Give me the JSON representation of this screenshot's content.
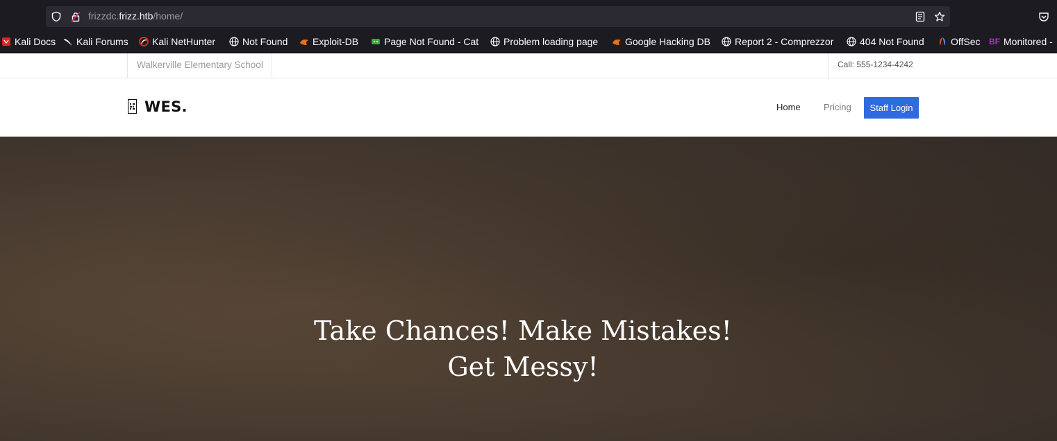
{
  "browser": {
    "url": {
      "host_prefix": "frizzdc.",
      "host_main": "frizz.htb",
      "path": "/home/"
    },
    "bookmarks": [
      {
        "label": "Kali Docs",
        "icon": "kali-docs-icon",
        "color": "#e02424"
      },
      {
        "label": "Kali Forums",
        "icon": "kali-dragon-icon",
        "color": "#ffffff"
      },
      {
        "label": "Kali NetHunter",
        "icon": "nethunter-icon",
        "color": "#e02424"
      },
      {
        "label": "Not Found",
        "icon": "globe-icon",
        "color": "#fbfbfe"
      },
      {
        "label": "Exploit-DB",
        "icon": "exploitdb-icon",
        "color": "#e8711a"
      },
      {
        "label": "Page Not Found - Cat",
        "icon": "cat-icon",
        "color": "#3aa655"
      },
      {
        "label": "Problem loading page",
        "icon": "globe-icon",
        "color": "#fbfbfe"
      },
      {
        "label": "Google Hacking DB",
        "icon": "exploitdb-icon",
        "color": "#e8711a"
      },
      {
        "label": "Report 2 - Comprezzor",
        "icon": "globe-icon",
        "color": "#fbfbfe"
      },
      {
        "label": "404 Not Found",
        "icon": "globe-icon",
        "color": "#fbfbfe"
      },
      {
        "label": "OffSec",
        "icon": "offsec-icon",
        "color": "#5a8df0"
      },
      {
        "label": "Monitored -",
        "icon": "bf-icon",
        "color": "#b02bd6",
        "icon_text": "BF"
      }
    ]
  },
  "site": {
    "school_name": "Walkerville Elementary School",
    "phone": "Call: 555-1234-4242",
    "brand": "WES.",
    "nav": {
      "home": "Home",
      "pricing": "Pricing",
      "login": "Staff Login"
    },
    "accent": "#2f6ae0",
    "hero_title": "Take Chances! Make Mistakes! Get Messy!"
  }
}
